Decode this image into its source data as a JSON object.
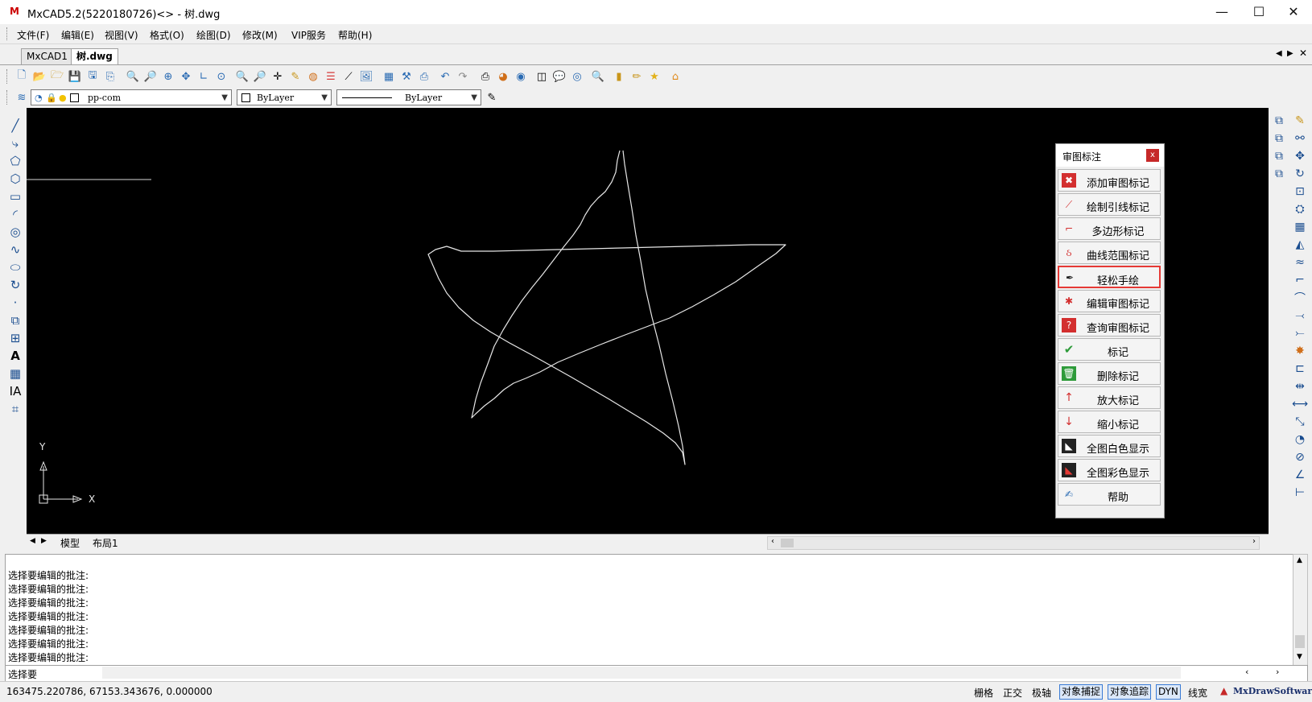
{
  "window": {
    "title": "MxCAD5.2(5220180726)<> - 树.dwg",
    "minimize": "—",
    "maximize": "☐",
    "close": "✕"
  },
  "menu": [
    "文件(F)",
    "编辑(E)",
    "视图(V)",
    "格式(O)",
    "绘图(D)",
    "修改(M)",
    "VIP服务",
    "帮助(H)"
  ],
  "doc_tabs": [
    "MxCAD1",
    "树.dwg"
  ],
  "layer_combo": "pp-com",
  "color_combo": "ByLayer",
  "linetype_combo": "ByLayer",
  "ucs": {
    "y": "Y",
    "x": "X"
  },
  "review_panel": {
    "title": "审图标注",
    "close": "x",
    "buttons": [
      {
        "label": "添加审图标记",
        "icon": "add-mark-icon"
      },
      {
        "label": "绘制引线标记",
        "icon": "leader-mark-icon"
      },
      {
        "label": "多边形标记",
        "icon": "polygon-mark-icon"
      },
      {
        "label": "曲线范围标记",
        "icon": "curve-mark-icon"
      },
      {
        "label": "轻松手绘",
        "icon": "pen-icon"
      },
      {
        "label": "编辑审图标记",
        "icon": "edit-mark-icon"
      },
      {
        "label": "查询审图标记",
        "icon": "query-mark-icon"
      },
      {
        "label": "标记",
        "icon": "check-icon"
      },
      {
        "label": "删除标记",
        "icon": "trash-icon"
      },
      {
        "label": "放大标记",
        "icon": "enlarge-icon"
      },
      {
        "label": "缩小标记",
        "icon": "shrink-icon"
      },
      {
        "label": "全图白色显示",
        "icon": "white-display-icon"
      },
      {
        "label": "全图彩色显示",
        "icon": "color-display-icon"
      },
      {
        "label": "帮助",
        "icon": "help-icon"
      }
    ]
  },
  "layout_tabs": [
    "模型",
    "布局1"
  ],
  "command_history": [
    "选择要编辑的批注:",
    "选择要编辑的批注:",
    "选择要编辑的批注:",
    "选择要编辑的批注:",
    "选择要编辑的批注:",
    "选择要编辑的批注:",
    "选择要编辑的批注:"
  ],
  "command_input": "选择要",
  "status": {
    "coords": "163475.220786,  67153.343676,  0.000000",
    "grid": "栅格",
    "ortho": "正交",
    "polar": "极轴",
    "osnap": "对象捕捉",
    "otrack": "对象追踪",
    "dyn": "DYN",
    "lineweight": "线宽",
    "brand": "MxDrawSoftware"
  },
  "colors": {
    "canvas": "#000000",
    "highlight": "#e53935",
    "accent": "#1a4d8f"
  }
}
